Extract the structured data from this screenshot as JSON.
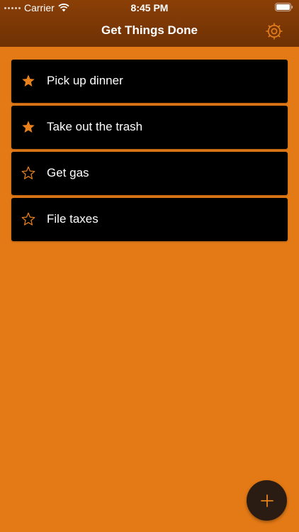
{
  "status_bar": {
    "carrier": "Carrier",
    "time": "8:45 PM"
  },
  "nav": {
    "title": "Get Things Done",
    "settings_icon": "gear-icon"
  },
  "tasks": [
    {
      "label": "Pick up dinner",
      "starred": true
    },
    {
      "label": "Take out the trash",
      "starred": true
    },
    {
      "label": "Get gas",
      "starred": false
    },
    {
      "label": "File taxes",
      "starred": false
    }
  ],
  "fab": {
    "icon": "plus-icon"
  },
  "colors": {
    "background": "#e47a16",
    "accent": "#e8801e",
    "nav_bar": "#7a3805",
    "row": "#000000"
  }
}
